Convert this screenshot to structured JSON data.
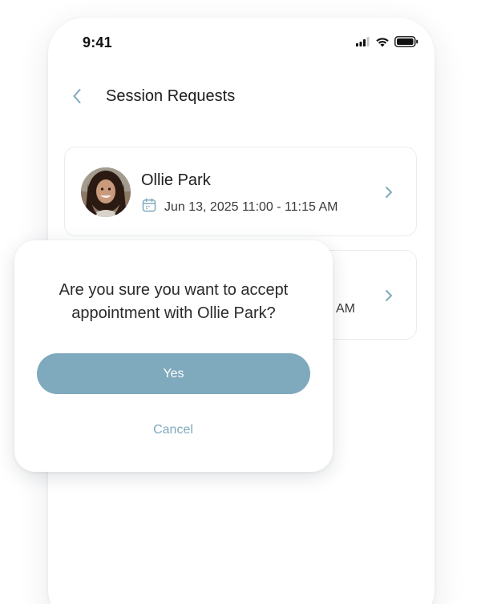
{
  "status_bar": {
    "time": "9:41",
    "icons": [
      "cellular-signal-icon",
      "wifi-icon",
      "battery-icon"
    ]
  },
  "header": {
    "back_icon": "chevron-left-icon",
    "title": "Session Requests"
  },
  "requests": [
    {
      "name": "Ollie Park",
      "datetime": "Jun 13, 2025 11:00 - 11:15 AM",
      "icons": [
        "avatar-photo",
        "calendar-icon",
        "chevron-right-icon"
      ]
    },
    {
      "visible_time_fragment": "AM",
      "icons": [
        "chevron-right-icon"
      ]
    }
  ],
  "dialog": {
    "message": "Are you sure you want to accept appointment with Ollie Park?",
    "confirm_label": "Yes",
    "cancel_label": "Cancel"
  },
  "colors": {
    "accent": "#7fa9bd",
    "text_primary": "#1d1d1f",
    "card_border": "#e9ecef"
  }
}
